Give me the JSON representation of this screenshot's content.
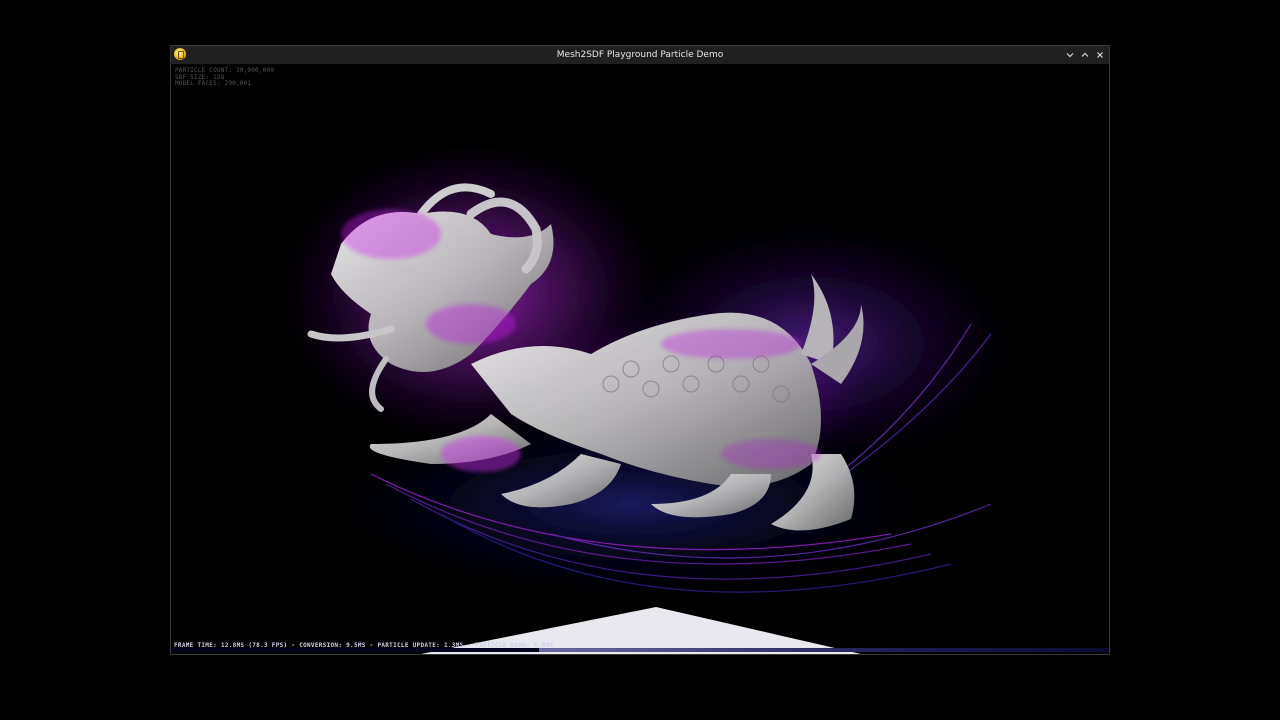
{
  "window": {
    "title": "Mesh2SDF Playground Particle Demo",
    "icon": "app-icon",
    "controls": [
      "minimize-icon",
      "maximize-icon",
      "close-icon"
    ]
  },
  "stats": {
    "particle_count": "PARTICLE COUNT: 30,000,000",
    "sdf_size": "SDF SIZE: 128",
    "model_faces": "MODEL FACES: 290,001"
  },
  "timing": {
    "text": "FRAME TIME: 12.8MS (78.3 FPS) - CONVERSION: 9.5MS - PARTICLE UPDATE: 1.3MS - PARTICLE DRAW: 1.0MS"
  },
  "colors": {
    "particle_magenta": "#c020e0",
    "particle_purple": "#6a20c0",
    "particle_blue": "#2a2aa0",
    "mesh": "#cfcfcf"
  }
}
